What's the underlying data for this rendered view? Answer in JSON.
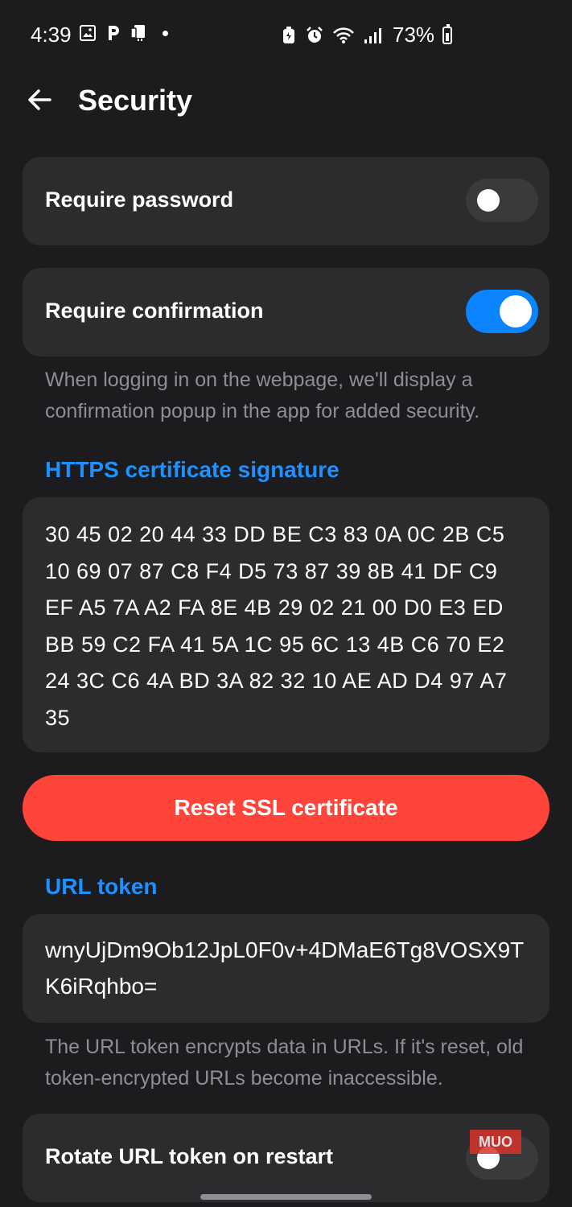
{
  "status_bar": {
    "time": "4:39",
    "battery": "73%",
    "left_icons": [
      "gallery-icon",
      "parking-icon",
      "device-icon"
    ],
    "right_icons": [
      "battery-saver-icon",
      "alarm-icon",
      "wifi-icon",
      "signal-icon"
    ]
  },
  "header": {
    "title": "Security",
    "back_icon": "arrow-left-icon"
  },
  "settings": {
    "require_password": {
      "label": "Require password",
      "enabled": false
    },
    "require_confirmation": {
      "label": "Require confirmation",
      "enabled": true
    },
    "confirmation_description": "When logging in on the webpage, we'll display a confirmation popup in the app for added security."
  },
  "certificate": {
    "header": "HTTPS certificate signature",
    "signature": "30 45 02 20 44 33 DD BE C3 83 0A 0C 2B C5 10 69 07 87 C8 F4 D5 73 87 39 8B 41 DF C9 EF A5 7A A2 FA 8E 4B 29 02 21 00 D0 E3 ED BB 59 C2 FA 41 5A 1C 95 6C 13 4B C6 70 E2 24 3C C6 4A BD 3A 82 32 10 AE AD D4 97 A7 35",
    "reset_label": "Reset SSL certificate"
  },
  "url_token": {
    "header": "URL token",
    "value": "wnyUjDm9Ob12JpL0F0v+4DMaE6Tg8VOSX9TK6iRqhbo=",
    "description": "The URL token encrypts data in URLs. If it's reset, old token-encrypted URLs become inaccessible.",
    "rotate": {
      "label": "Rotate URL token on restart",
      "enabled": false
    }
  },
  "watermark": "MUO",
  "colors": {
    "background": "#1c1c1e",
    "card": "#2c2c2e",
    "accent": "#0a84ff",
    "destructive": "#ff453a"
  }
}
